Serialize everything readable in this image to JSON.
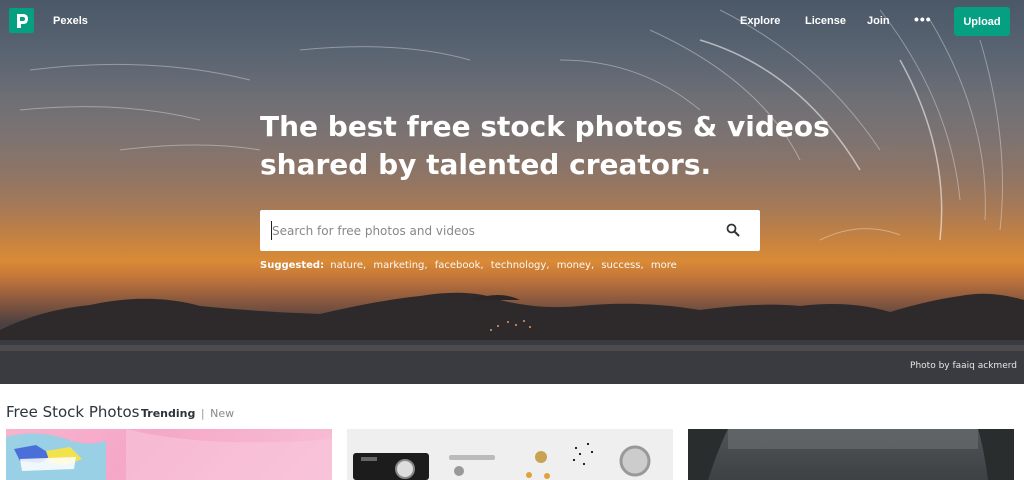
{
  "nav": {
    "brand": "Pexels",
    "links": [
      "Explore",
      "License",
      "Join"
    ],
    "more": "•••",
    "upload_label": "Upload"
  },
  "hero": {
    "headline_line1": "The best free stock photos & videos",
    "headline_line2": "shared by talented creators.",
    "search_placeholder": "Search for free photos and videos",
    "suggested_label": "Suggested:",
    "suggested_tags": [
      "nature,",
      "marketing,",
      "facebook,",
      "technology,",
      "money,",
      "success,",
      "more"
    ],
    "photo_credit": "Photo by faaiq ackmerd"
  },
  "section": {
    "title": "Free Stock Photos",
    "tab_trending": "Trending",
    "tab_separator": "|",
    "tab_new": "New"
  },
  "colors": {
    "accent": "#05a081"
  },
  "icons": {
    "logo": "pexels-logo-icon",
    "search": "search-icon",
    "more": "more-dots-icon"
  }
}
